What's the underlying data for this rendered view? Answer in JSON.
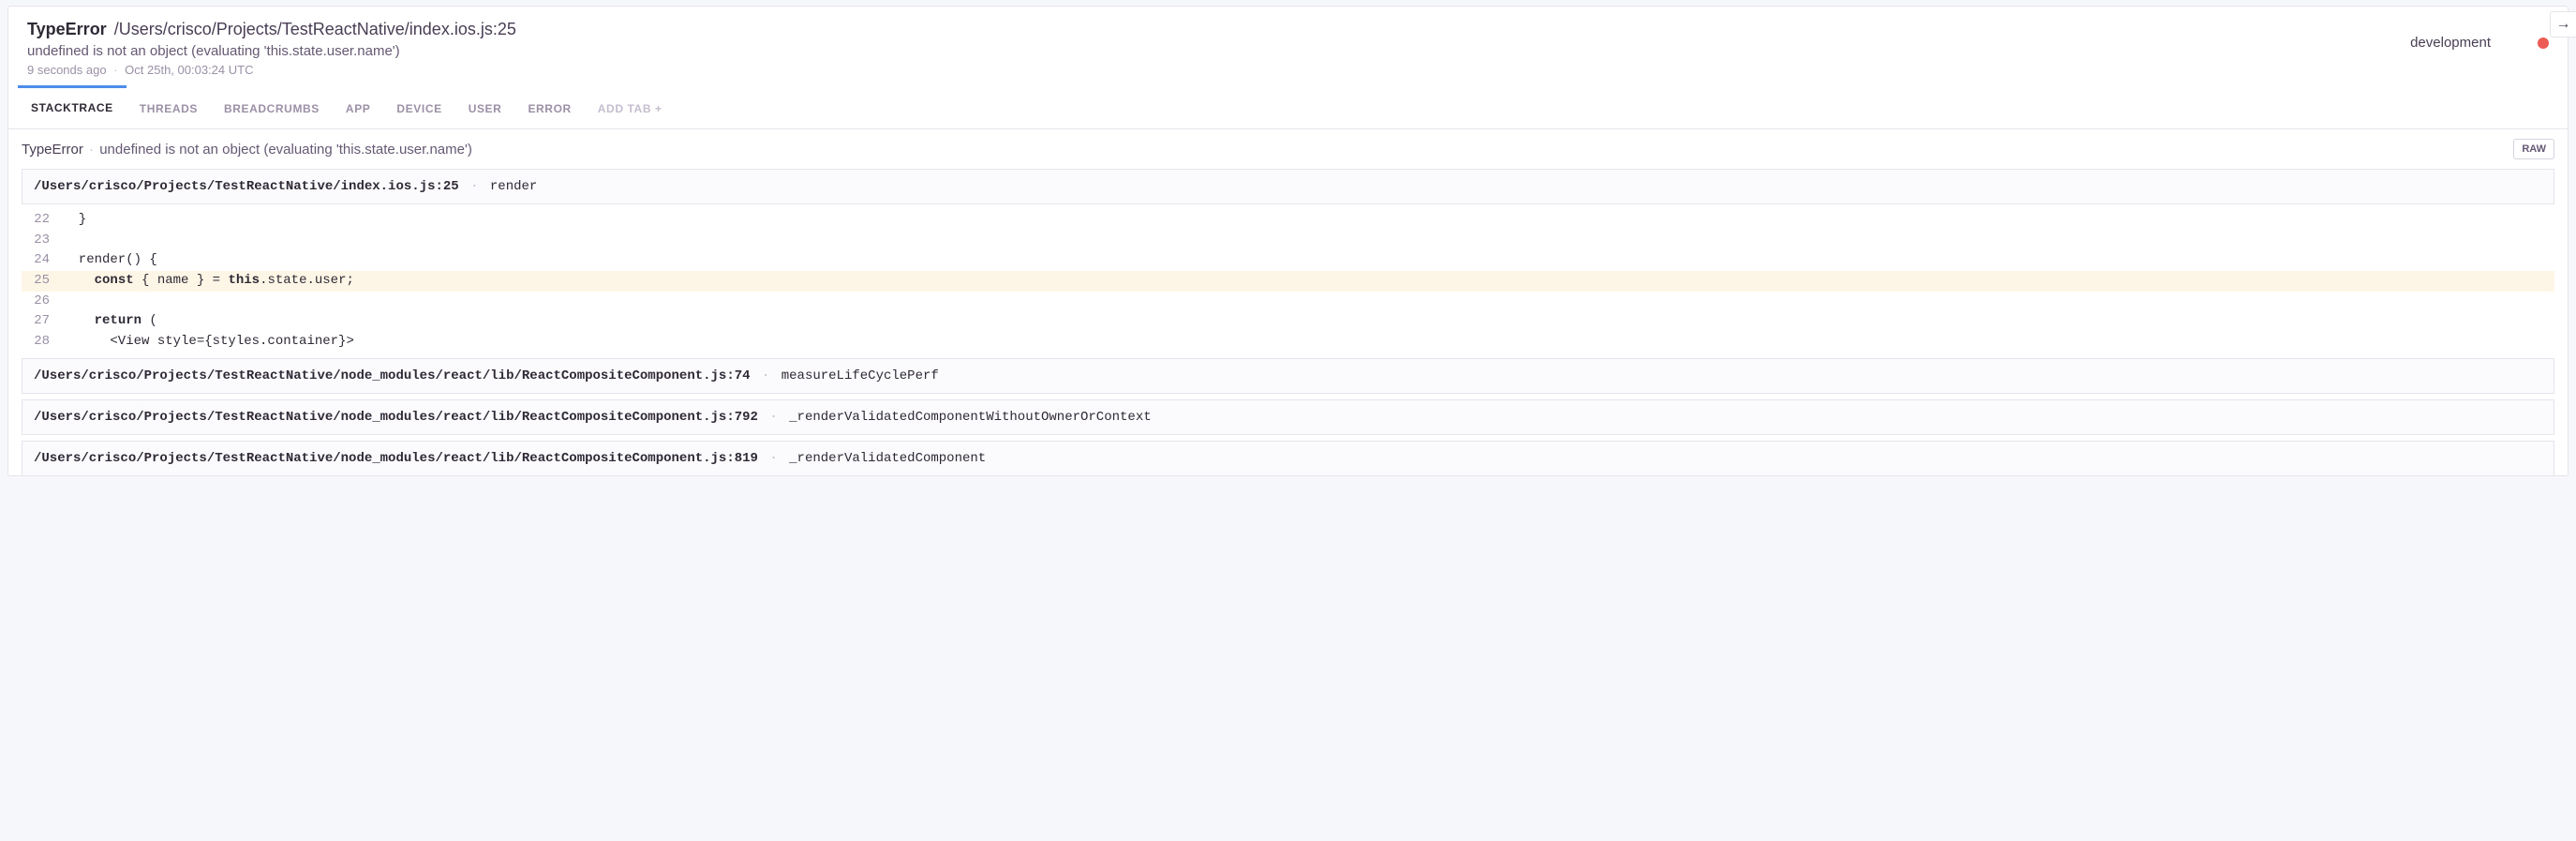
{
  "header": {
    "error_type": "TypeError",
    "location": "/Users/crisco/Projects/TestReactNative/index.ios.js:25",
    "message": "undefined is not an object (evaluating 'this.state.user.name')",
    "age": "9 seconds ago",
    "timestamp": "Oct 25th, 00:03:24 UTC",
    "environment": "development"
  },
  "tabs": {
    "stacktrace": "STACKTRACE",
    "threads": "THREADS",
    "breadcrumbs": "BREADCRUMBS",
    "app": "APP",
    "device": "DEVICE",
    "user": "USER",
    "error": "ERROR",
    "add": "ADD TAB +"
  },
  "subheader": {
    "error_type": "TypeError",
    "message": "undefined is not an object (evaluating 'this.state.user.name')",
    "raw": "RAW"
  },
  "frames": [
    {
      "path": "/Users/crisco/Projects/TestReactNative/index.ios.js:25",
      "fn": "render"
    },
    {
      "path": "/Users/crisco/Projects/TestReactNative/node_modules/react/lib/ReactCompositeComponent.js:74",
      "fn": "measureLifeCyclePerf"
    },
    {
      "path": "/Users/crisco/Projects/TestReactNative/node_modules/react/lib/ReactCompositeComponent.js:792",
      "fn": "_renderValidatedComponentWithoutOwnerOrContext"
    },
    {
      "path": "/Users/crisco/Projects/TestReactNative/node_modules/react/lib/ReactCompositeComponent.js:819",
      "fn": "_renderValidatedComponent"
    }
  ],
  "code": {
    "lines": [
      {
        "n": "22",
        "hl": false,
        "pre": "  }",
        "kw": "",
        "post": ""
      },
      {
        "n": "23",
        "hl": false,
        "pre": "",
        "kw": "",
        "post": ""
      },
      {
        "n": "24",
        "hl": false,
        "pre": "  render() {",
        "kw": "",
        "post": ""
      },
      {
        "n": "25",
        "hl": true,
        "pre": "    ",
        "kw": "const",
        "mid": " { name } = ",
        "kw2": "this",
        "post": ".state.user;"
      },
      {
        "n": "26",
        "hl": false,
        "pre": "",
        "kw": "",
        "post": ""
      },
      {
        "n": "27",
        "hl": false,
        "pre": "    ",
        "kw": "return",
        "post": " ("
      },
      {
        "n": "28",
        "hl": false,
        "pre": "      <View style={styles.container}>",
        "kw": "",
        "post": ""
      }
    ]
  }
}
